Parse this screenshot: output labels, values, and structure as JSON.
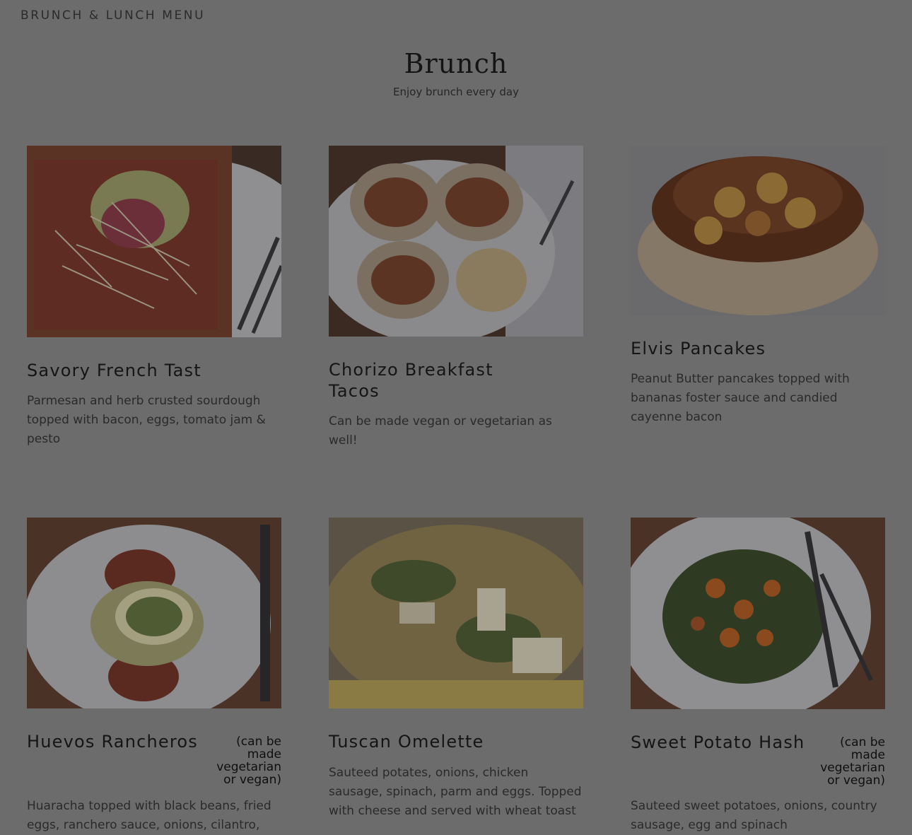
{
  "nav": {
    "title": "BRUNCH & LUNCH MENU"
  },
  "hero": {
    "title": "Brunch",
    "subtitle": "Enjoy brunch every day"
  },
  "items": [
    {
      "name": "Savory French Tast",
      "note": "",
      "description": "Parmesan and herb crusted sourdough topped with bacon, eggs, tomato jam & pesto"
    },
    {
      "name": "Chorizo Breakfast Tacos",
      "note": "",
      "description": "Can be made vegan or vegetarian as well!"
    },
    {
      "name": "Elvis Pancakes",
      "note": "",
      "description": "Peanut Butter pancakes topped with bananas foster sauce and candied cayenne bacon"
    },
    {
      "name": "Huevos Rancheros",
      "note": "(can be made vegetarian or vegan)",
      "description": "Huaracha topped with black beans, fried eggs, ranchero sauce, onions, cilantro,"
    },
    {
      "name": "Tuscan Omelette",
      "note": "",
      "description": "Sauteed potates, onions, chicken sausage, spinach, parm and eggs.  Topped with cheese and served with wheat toast"
    },
    {
      "name": "Sweet Potato Hash",
      "note": "(can be made vegetarian or vegan)",
      "description": "Sauteed sweet potatoes, onions, country sausage, egg and spinach"
    }
  ]
}
